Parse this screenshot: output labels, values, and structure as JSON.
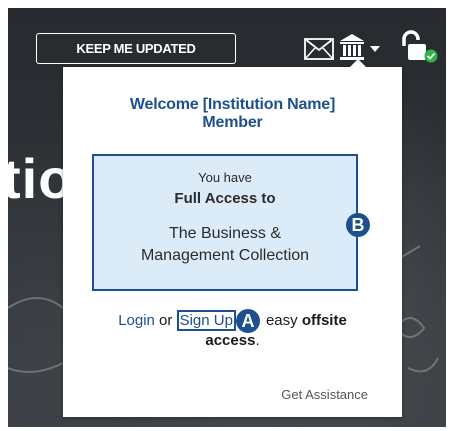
{
  "header": {
    "keep_updated_label": "KEEP ME UPDATED",
    "icons": [
      "envelope-icon",
      "institution-icon",
      "chevron-down-icon",
      "unlocked-padlock-icon",
      "check-badge-icon"
    ]
  },
  "background": {
    "partial_text": "tio"
  },
  "popup": {
    "welcome_line1": "Welcome [Institution Name]",
    "welcome_line2": "Member",
    "access_box": {
      "you_have": "You have",
      "full_access": "Full Access to",
      "collection_line1": "The Business &",
      "collection_line2": "Management Collection"
    },
    "login_text": "Login",
    "or_text": " or ",
    "signup_text": "Sign Up",
    "easy_text": "easy",
    "offsite_text": "offsite",
    "access_text": "access",
    "period_text": ".",
    "get_assistance": "Get Assistance"
  },
  "callouts": {
    "a": "A",
    "b": "B"
  },
  "colors": {
    "brand_blue": "#1e4f8f",
    "box_fill": "#dcebf8",
    "status_green": "#2db34a",
    "background_dark": "#2a2e33"
  }
}
